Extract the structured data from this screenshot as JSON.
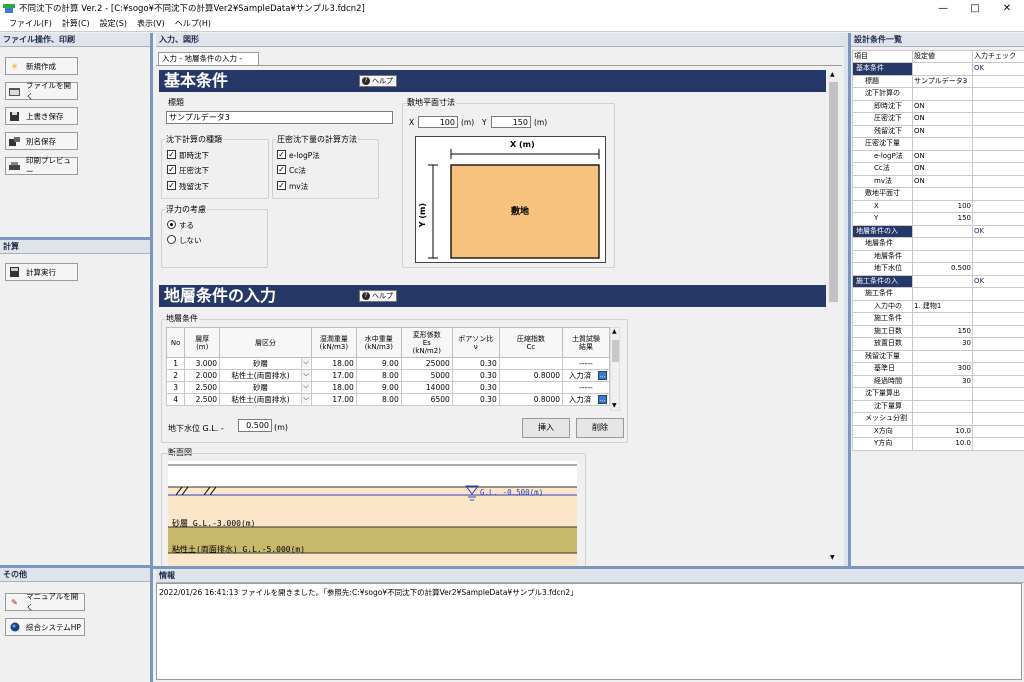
{
  "window": {
    "title": "不同沈下の計算 Ver.2 - [C:¥sogo¥不同沈下の計算Ver2¥SampleData¥サンプル3.fdcn2]"
  },
  "menu": [
    "ファイル(F)",
    "計算(C)",
    "設定(S)",
    "表示(V)",
    "ヘルプ(H)"
  ],
  "left": {
    "file_header": "ファイル操作、印刷",
    "file_buttons": {
      "new": "新規作成",
      "open": "ファイルを開く",
      "save": "上書き保存",
      "saveas": "別名保存",
      "preview": "印刷プレビュー"
    },
    "calc_header": "計算",
    "calc_button": "計算実行",
    "other_header": "その他",
    "other_buttons": {
      "manual": "マニュアルを開く",
      "hp": "綜合システムHP"
    }
  },
  "center": {
    "header": "入力、図形",
    "tab": "入力 - 地層条件の入力 -",
    "basic": {
      "title": "基本条件",
      "help": "ヘルプ",
      "name_label": "標題",
      "name_value": "サンプルデータ3",
      "calc_type_label": "沈下計算の種類",
      "calc_types": [
        "即時沈下",
        "圧密沈下",
        "残留沈下"
      ],
      "method_label": "圧密沈下量の計算方法",
      "methods": [
        "e-logP法",
        "Cc法",
        "mv法"
      ],
      "buoyancy_label": "浮力の考慮",
      "buoyancy_opts": [
        "する",
        "しない"
      ],
      "plan_label": "敷地平面寸法",
      "x_label": "X",
      "x_value": "100",
      "x_unit": "(m)",
      "y_label": "Y",
      "y_value": "150",
      "y_unit": "(m)",
      "fig_x": "X (m)",
      "fig_y": "Y (m)",
      "fig_site": "敷地"
    },
    "layer": {
      "title": "地層条件の入力",
      "help": "ヘルプ",
      "group_label": "地層条件",
      "headers": [
        "No",
        "層厚\n(m)",
        "層区分",
        "湿潤重量\n(kN/m3)",
        "水中重量\n(kN/m3)",
        "変形係数\nEs\n(kN/m2)",
        "ポアソン比\nν",
        "圧縮指数\nCc",
        "土質試験\n結果"
      ],
      "rows": [
        {
          "no": "1",
          "thick": "3.000",
          "type": "砂層",
          "wet": "18.00",
          "sub": "9.00",
          "es": "25000",
          "nu": "0.30",
          "cc": "",
          "test": "-----"
        },
        {
          "no": "2",
          "thick": "2.000",
          "type": "粘性土(両面排水)",
          "wet": "17.00",
          "sub": "8.00",
          "es": "5000",
          "nu": "0.30",
          "cc": "0.8000",
          "test": "入力済"
        },
        {
          "no": "3",
          "thick": "2.500",
          "type": "砂層",
          "wet": "18.00",
          "sub": "9.00",
          "es": "14000",
          "nu": "0.30",
          "cc": "",
          "test": "-----"
        },
        {
          "no": "4",
          "thick": "2.500",
          "type": "粘性土(両面排水)",
          "wet": "17.00",
          "sub": "8.00",
          "es": "6500",
          "nu": "0.30",
          "cc": "0.8000",
          "test": "入力済"
        }
      ],
      "gw_label": "地下水位 G.L. -",
      "gw_value": "0.500",
      "gw_unit": "(m)",
      "insert": "挿入",
      "delete": "削除",
      "section_label": "断面図",
      "section_gl": "G.L. -0.500(m)",
      "section_sand": "砂層 G.L.-3.000(m)",
      "section_clay": "粘性土(両面排水) G.L.-5.000(m)"
    }
  },
  "right": {
    "header": "設計条件一覧",
    "cols": [
      "項目",
      "設定値",
      "入力チェック"
    ],
    "rows": [
      {
        "name": "基本条件",
        "value": "",
        "check": "OK",
        "level": 0,
        "sec": true
      },
      {
        "name": "標題",
        "value": "サンプルデータ3",
        "check": "",
        "level": 1
      },
      {
        "name": "沈下計算の",
        "value": "",
        "check": "",
        "level": 1
      },
      {
        "name": "即時沈下",
        "value": "ON",
        "check": "",
        "level": 2
      },
      {
        "name": "圧密沈下",
        "value": "ON",
        "check": "",
        "level": 2
      },
      {
        "name": "残留沈下",
        "value": "ON",
        "check": "",
        "level": 2
      },
      {
        "name": "圧密沈下量",
        "value": "",
        "check": "",
        "level": 1
      },
      {
        "name": "e-logP法",
        "value": "ON",
        "check": "",
        "level": 2
      },
      {
        "name": "Cc法",
        "value": "ON",
        "check": "",
        "level": 2
      },
      {
        "name": "mv法",
        "value": "ON",
        "check": "",
        "level": 2
      },
      {
        "name": "敷地平面寸",
        "value": "",
        "check": "",
        "level": 1
      },
      {
        "name": "X",
        "value": "100",
        "check": "",
        "level": 2,
        "num": true
      },
      {
        "name": "Y",
        "value": "150",
        "check": "",
        "level": 2,
        "num": true
      },
      {
        "name": "地層条件の入",
        "value": "",
        "check": "OK",
        "level": 0,
        "sec": true
      },
      {
        "name": "地層条件",
        "value": "",
        "check": "",
        "level": 1
      },
      {
        "name": "地層条件",
        "value": "",
        "check": "",
        "level": 2
      },
      {
        "name": "地下水位",
        "value": "0.500",
        "check": "",
        "level": 2,
        "num": true
      },
      {
        "name": "施工条件の入",
        "value": "",
        "check": "OK",
        "level": 0,
        "sec": true
      },
      {
        "name": "施工条件",
        "value": "",
        "check": "",
        "level": 1
      },
      {
        "name": "入力中の",
        "value": "1. 建物1",
        "check": "",
        "level": 2
      },
      {
        "name": "施工条件",
        "value": "",
        "check": "",
        "level": 2
      },
      {
        "name": "施工日数",
        "value": "150",
        "check": "",
        "level": 2,
        "num": true
      },
      {
        "name": "放置日数",
        "value": "30",
        "check": "",
        "level": 2,
        "num": true
      },
      {
        "name": "残留沈下量",
        "value": "",
        "check": "",
        "level": 1
      },
      {
        "name": "基準日",
        "value": "300",
        "check": "",
        "level": 2,
        "num": true
      },
      {
        "name": "経過時間",
        "value": "30",
        "check": "",
        "level": 2,
        "num": true
      },
      {
        "name": "沈下量算出",
        "value": "",
        "check": "",
        "level": 1
      },
      {
        "name": "沈下量算",
        "value": "",
        "check": "",
        "level": 2
      },
      {
        "name": "メッシュ分割",
        "value": "",
        "check": "",
        "level": 1
      },
      {
        "name": "X方向",
        "value": "10.0",
        "check": "",
        "level": 2,
        "num": true
      },
      {
        "name": "Y方向",
        "value": "10.0",
        "check": "",
        "level": 2,
        "num": true
      }
    ]
  },
  "info": {
    "header": "情報",
    "message": "2022/01/26 16:41:13 ファイルを開きました。「参照先:C:¥sogo¥不同沈下の計算Ver2¥SampleData¥サンプル3.fdcn2」"
  }
}
